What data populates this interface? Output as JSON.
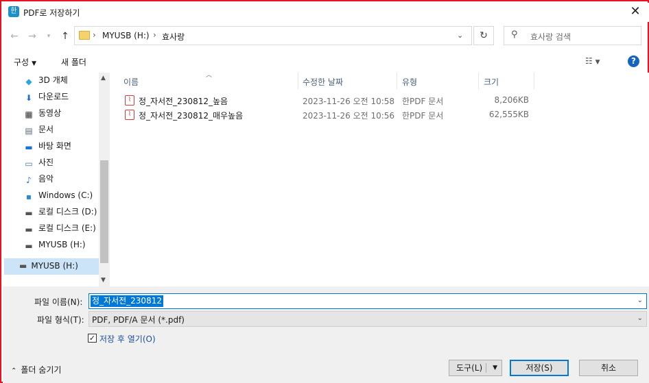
{
  "window": {
    "app_icon_glyph": "한",
    "title": "PDF로 저장하기",
    "close_glyph": "✕"
  },
  "address": {
    "crumbs": [
      "MYUSB (H:)",
      "효사랑"
    ],
    "search_placeholder": "효사랑 검색"
  },
  "toolbar": {
    "organize_label": "구성",
    "new_folder_label": "새 폴더"
  },
  "nav_pane": {
    "items": [
      {
        "label": "3D 개체",
        "icon": "cube-3d-icon"
      },
      {
        "label": "다운로드",
        "icon": "download-icon"
      },
      {
        "label": "동영상",
        "icon": "video-icon"
      },
      {
        "label": "문서",
        "icon": "document-icon"
      },
      {
        "label": "바탕 화면",
        "icon": "desktop-icon"
      },
      {
        "label": "사진",
        "icon": "picture-icon"
      },
      {
        "label": "음악",
        "icon": "music-icon"
      },
      {
        "label": "Windows (C:)",
        "icon": "windows-drive-icon"
      },
      {
        "label": "로컬 디스크 (D:)",
        "icon": "drive-icon"
      },
      {
        "label": "로컬 디스크 (E:)",
        "icon": "drive-icon"
      },
      {
        "label": "MYUSB (H:)",
        "icon": "usb-drive-icon"
      }
    ],
    "selected": "MYUSB (H:)"
  },
  "file_list": {
    "columns": [
      "이름",
      "수정한 날짜",
      "유형",
      "크기"
    ],
    "rows": [
      {
        "name": "정_자서전_230812_높음",
        "modified": "2023-11-26 오전 10:58",
        "type": "한PDF 문서",
        "size": "8,206KB"
      },
      {
        "name": "정_자서전_230812_매우높음",
        "modified": "2023-11-26 오전 10:56",
        "type": "한PDF 문서",
        "size": "62,555KB"
      }
    ]
  },
  "save_form": {
    "filename_label": "파일 이름(N):",
    "filename_value": "정_자서전_230812",
    "filetype_label": "파일 형식(T):",
    "filetype_value": "PDF, PDF/A 문서 (*.pdf)",
    "open_after_label": "저장 후 열기(O)",
    "open_after_checked": true,
    "hide_folders_label": "폴더 숨기기",
    "tools_label": "도구(L)",
    "save_label": "저장(S)",
    "cancel_label": "취소"
  },
  "colors": {
    "accent": "#0078d7",
    "frame_border": "#e81123",
    "selected_row": "#cce4f7"
  }
}
